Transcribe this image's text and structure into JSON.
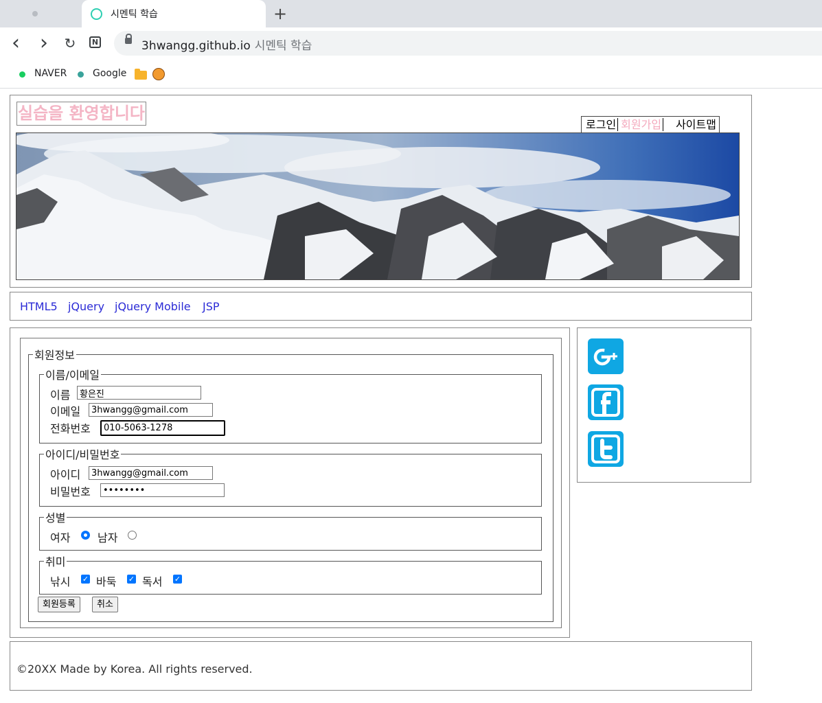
{
  "browser": {
    "tab_title": "시멘틱 학습",
    "new_tab": "+",
    "url_domain": "3hwangg.github.io",
    "url_title": "시멘틱 학습",
    "nav": {
      "back": "‹",
      "forward": "›",
      "reload": "↻"
    },
    "bookmarks": [
      {
        "label": "NAVER",
        "color": "#19ce60"
      },
      {
        "label": "Google",
        "color": "#3aa39b"
      }
    ]
  },
  "header": {
    "title": "실습을 환영합니다",
    "links": [
      "로그인",
      "회원가입",
      "사이트맵"
    ]
  },
  "menu": [
    "HTML5",
    "jQuery",
    "jQuery Mobile",
    "JSP"
  ],
  "form": {
    "legend": "회원정보",
    "name_email": {
      "legend": "이름/이메일",
      "name_label": "이름",
      "name_value": "황은진",
      "email_label": "이메일",
      "email_value": "3hwangg@gmail.com",
      "phone_label": "전화번호",
      "phone_value": "010-5063-1278"
    },
    "account": {
      "legend": "아이디/비밀번호",
      "id_label": "아이디",
      "id_value": "3hwangg@gmail.com",
      "pw_label": "비밀번호",
      "pw_value": "••••••••"
    },
    "gender": {
      "legend": "성별",
      "female": "여자",
      "male": "남자",
      "selected": "여자"
    },
    "hobby": {
      "legend": "취미",
      "items": [
        "낚시",
        "바둑",
        "독서"
      ],
      "checked": [
        true,
        true,
        true
      ]
    },
    "submit": "회원등록",
    "cancel": "취소"
  },
  "social": [
    "google-plus-icon",
    "facebook-icon",
    "twitter-icon"
  ],
  "footer": "©20XX Made by Korea. All rights reserved.",
  "colors": {
    "accent_pink": "#f4b5c5",
    "link_blue": "#2b2bd6",
    "social_blue": "#0fa7e3"
  }
}
